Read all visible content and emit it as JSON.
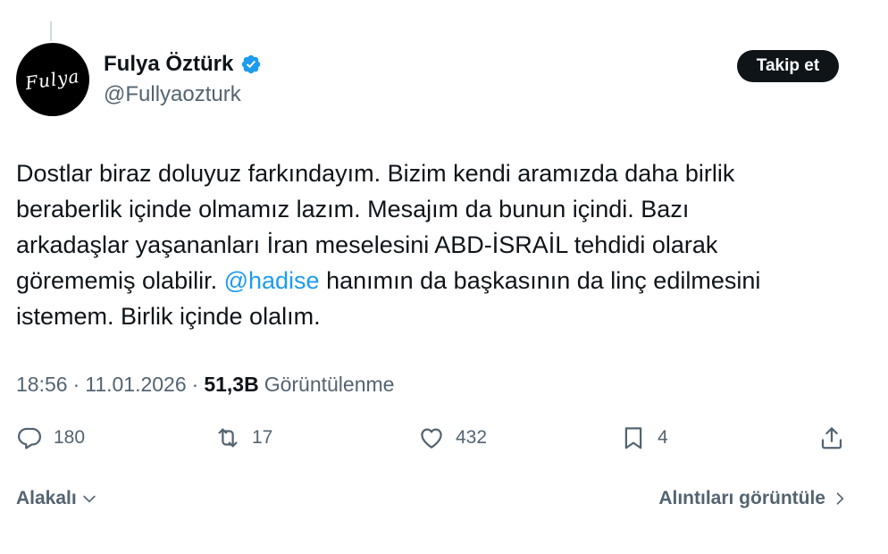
{
  "author": {
    "display_name": "Fulya Öztürk",
    "handle": "@Fullyaozturk",
    "avatar_text": "Fulya",
    "verified": true
  },
  "follow_button": {
    "label": "Takip et"
  },
  "tweet": {
    "text_before_mention": "Dostlar biraz doluyuz farkındayım. Bizim kendi aramızda daha birlik\nberaberlik içinde olmamız lazım. Mesajım da bunun içindi. Bazı\narkadaşlar yaşananları İran meselesini ABD-İSRAİL tehdidi olarak\ngörememiş olabilir. ",
    "mention": "@hadise",
    "text_after_mention": " hanımın da başkasının da linç edilmesini\nistemem. Birlik içinde olalım."
  },
  "meta": {
    "time": "18:56",
    "separator_1": "·",
    "date": "11.01.2026",
    "separator_2": "·",
    "views_count": "51,3B",
    "views_label": "Görüntülenme"
  },
  "actions": {
    "replies": "180",
    "reposts": "17",
    "likes": "432",
    "bookmarks": "4"
  },
  "footer": {
    "related_label": "Alakalı",
    "quotes_label": "Alıntıları görüntüle"
  },
  "colors": {
    "accent": "#1d9bf0",
    "text_primary": "#0f1419",
    "text_secondary": "#536471"
  },
  "icons": {
    "verified": "verified-badge-icon",
    "reply": "reply-icon",
    "repost": "repost-icon",
    "like": "heart-icon",
    "bookmark": "bookmark-icon",
    "share": "share-icon",
    "related_chevron": "chevron-down-icon",
    "quotes_chevron": "chevron-right-icon"
  }
}
